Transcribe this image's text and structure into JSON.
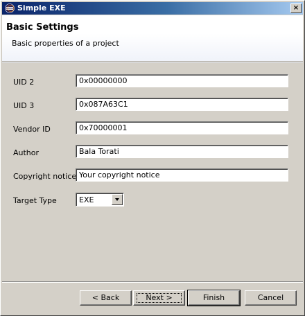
{
  "window": {
    "title": "Simple EXE",
    "close_glyph": "×"
  },
  "header": {
    "title": "Basic Settings",
    "description": "Basic properties of a project"
  },
  "form": {
    "rows": [
      {
        "label": "UID 2",
        "value": "0x00000000"
      },
      {
        "label": "UID 3",
        "value": "0x087A63C1"
      },
      {
        "label": "Vendor ID",
        "value": "0x70000001"
      },
      {
        "label": "Author",
        "value": "Bala Torati"
      },
      {
        "label": "Copyright notice",
        "value": "Your copyright notice"
      }
    ],
    "target_type": {
      "label": "Target Type",
      "value": "EXE"
    }
  },
  "buttons": {
    "back": "< Back",
    "next": "Next >",
    "finish": "Finish",
    "cancel": "Cancel"
  }
}
